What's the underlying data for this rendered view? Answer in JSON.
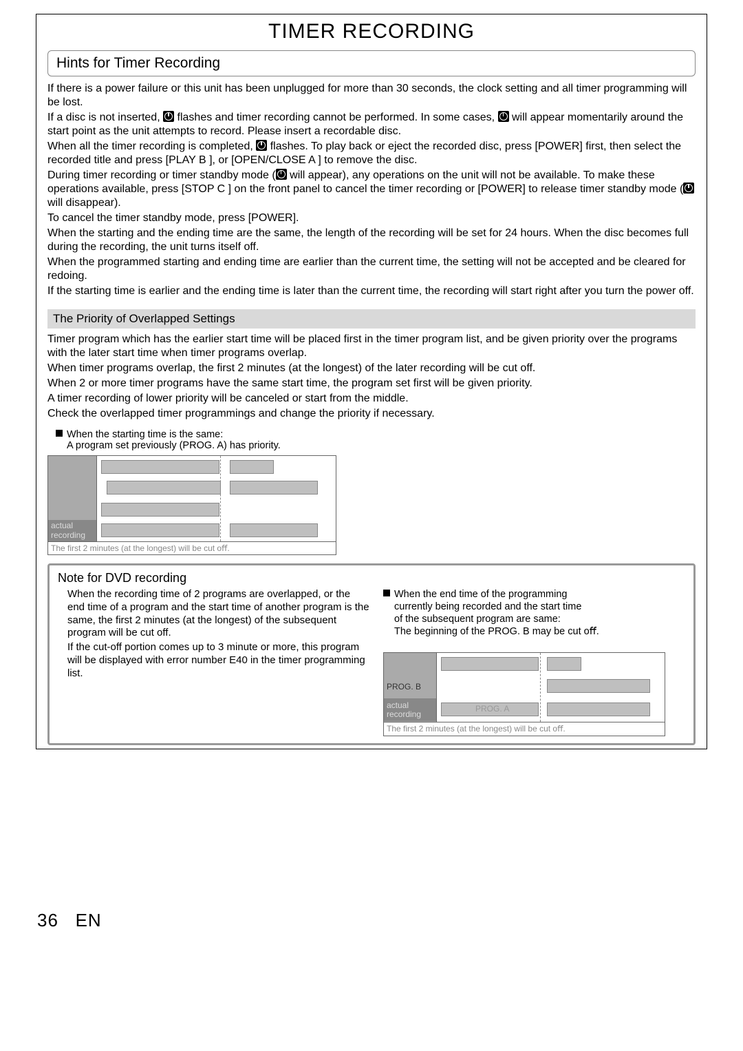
{
  "page": {
    "title": "TIMER RECORDING",
    "footer_page": "36",
    "footer_lang": "EN"
  },
  "hints": {
    "heading": "Hints for Timer Recording",
    "p1": "If there is a power failure or this unit has been unplugged for more than 30 seconds, the clock setting and all timer programming will be lost.",
    "p2a": "If a disc is not inserted, ",
    "p2b": " flashes and timer recording cannot be performed. In some cases, ",
    "p2c": " will appear momentarily around the start point as the unit attempts to record. Please insert a recordable disc.",
    "p3a": "When all the timer recording is completed, ",
    "p3b": " flashes. To play back or eject the recorded disc, press [POWER] first, then select the recorded title and press [PLAY B ], or [OPEN/CLOSE A ] to remove the disc.",
    "p4a": "During timer recording or timer standby mode (",
    "p4b": " will appear), any operations on the unit will not be available. To make these operations available, press [STOP C ] on the front panel to cancel the timer recording or [POWER] to release timer standby mode (",
    "p4c": " will disappear).",
    "p5": "To cancel the timer standby mode, press [POWER].",
    "p6": "When the starting and the ending time are the same, the length of the recording will be set for 24 hours. When the disc becomes full during the recording, the unit turns itself off.",
    "p7": "When the programmed starting and ending time are earlier than the current time, the setting will not be accepted and be cleared for redoing.",
    "p8": "If the starting time is earlier and the ending time is later than the current time, the recording will start right after you turn the power off."
  },
  "priority": {
    "heading": "The Priority of Overlapped Settings",
    "p1": "Timer program which has the earlier start time will be placed first in the timer program list, and be given priority over the programs with the later start time when timer programs overlap.",
    "p2": "When timer programs overlap, the first 2 minutes (at the longest) of the later recording will be cut off.",
    "p3": "When 2 or more timer programs have the same start time, the program set first will be given priority.",
    "p4": "A timer recording of lower priority will be canceled or start from the middle.",
    "p5": "Check the overlapped timer programmings and change the priority if necessary.",
    "bullet_line1": "When the starting time is the same:",
    "bullet_line2": "A program set previously (PROG. A) has priority.",
    "diagram1_actual1": "actual",
    "diagram1_actual2": "recording",
    "diagram1_footer": "The ﬁrst 2 minutes (at the longest) will be cut oﬀ."
  },
  "dvd": {
    "heading": "Note for DVD recording",
    "left_p1": "When the recording time of 2 programs are overlapped, or the end time of a program and the start time of another program is the same, the first 2 minutes (at the longest) of the subsequent program will be cut off.",
    "left_p2": "If the cut-off portion comes up to 3 minute or more, this program will be displayed with error number E40 in the timer programming list.",
    "right_bullet_l1": "When the end time of the programming",
    "right_bullet_l2": "currently being recorded and the start time",
    "right_bullet_l3": "of the subsequent program are same:",
    "right_bullet_l4": "The beginning of the PROG. B may be cut oﬀ.",
    "diagram2_progb": "PROG. B",
    "diagram2_proga": "PROG. A",
    "diagram2_actual1": "actual",
    "diagram2_actual2": "recording",
    "diagram2_footer": "The ﬁrst 2 minutes (at the longest) will be cut oﬀ."
  }
}
